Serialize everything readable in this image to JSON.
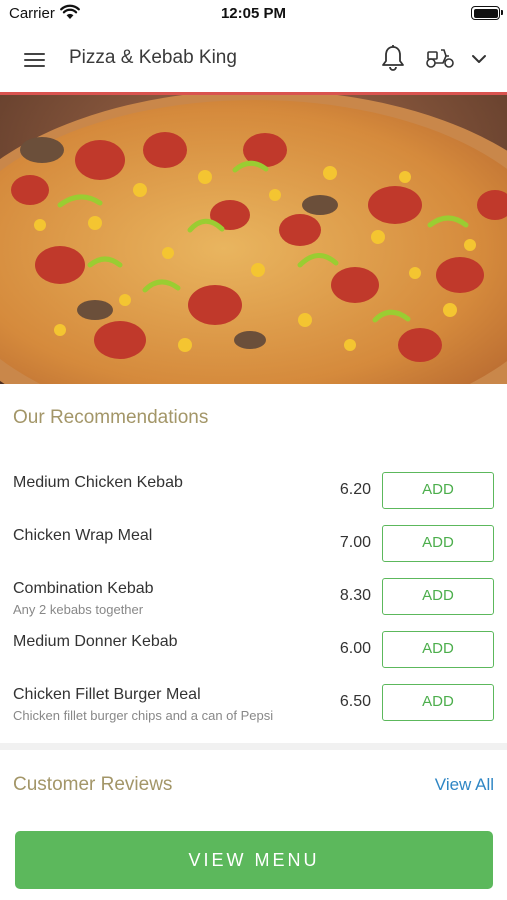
{
  "status_bar": {
    "carrier": "Carrier",
    "time": "12:05 PM"
  },
  "header": {
    "store_name": "Pizza & Kebab King"
  },
  "icons": {
    "menu": "hamburger-icon",
    "notifications": "bell-icon",
    "delivery": "scooter-icon",
    "dropdown": "chevron-down-icon"
  },
  "hero": {
    "image": "pizza-photo"
  },
  "recommendations": {
    "title": "Our Recommendations",
    "items": [
      {
        "name": "Medium Chicken Kebab",
        "description": "",
        "price": "6.20",
        "button": "ADD"
      },
      {
        "name": "Chicken Wrap Meal",
        "description": "",
        "price": "7.00",
        "button": "ADD"
      },
      {
        "name": "Combination Kebab",
        "description": "Any 2 kebabs together",
        "price": "8.30",
        "button": "ADD"
      },
      {
        "name": "Medium Donner Kebab",
        "description": "",
        "price": "6.00",
        "button": "ADD"
      },
      {
        "name": "Chicken Fillet Burger Meal",
        "description": "Chicken fillet burger chips and a can of Pepsi",
        "price": "6.50",
        "button": "ADD"
      }
    ]
  },
  "reviews": {
    "title": "Customer Reviews",
    "view_all": "View All"
  },
  "footer": {
    "view_menu": "VIEW MENU"
  },
  "colors": {
    "accent_green": "#5cb85c",
    "section_title": "#a39668",
    "link_blue": "#2f86c4",
    "header_rule": "#d9534f"
  }
}
